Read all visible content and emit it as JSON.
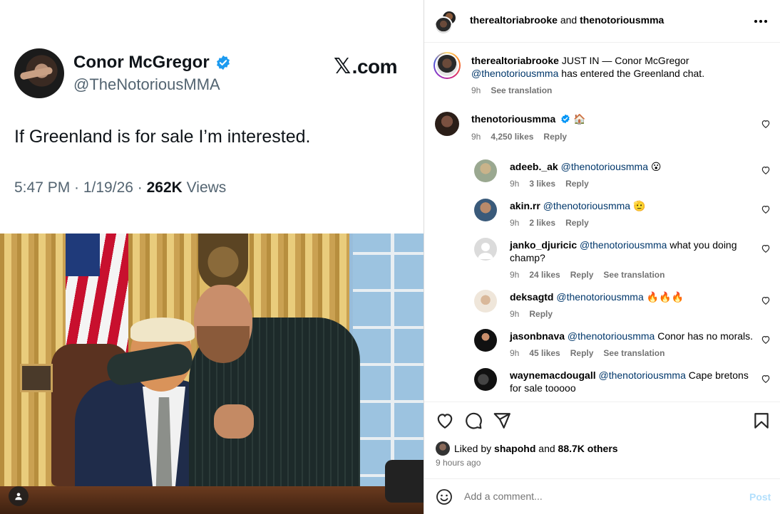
{
  "tweet": {
    "name": "Conor McGregor",
    "handle": "@TheNotoriousMMA",
    "site": "X.com",
    "site_x": "𝕏",
    "site_rest": ".com",
    "text": "If Greenland is for sale I’m interested.",
    "time": "5:47 PM · 1/19/26 · ",
    "views_count": "262K",
    "views_label": " Views"
  },
  "header": {
    "user1": "therealtoriabrooke",
    "and": " and ",
    "user2": "thenotoriousmma"
  },
  "caption": {
    "user": "therealtoriabrooke",
    "text": " JUST IN — Conor McGregor ",
    "mention": "@thenotoriousmma",
    "text2": " has entered the Greenland chat.",
    "time": "9h",
    "translate": "See translation"
  },
  "top_comment": {
    "user": "thenotoriousmma",
    "emoji": "🏠",
    "time": "9h",
    "likes": "4,250 likes",
    "reply": "Reply"
  },
  "replies": [
    {
      "user": "adeeb._ak",
      "mention": "@thenotoriousmma",
      "text": " 😮",
      "time": "9h",
      "likes": "3 likes",
      "reply": "Reply",
      "translate": ""
    },
    {
      "user": "akin.rr",
      "mention": "@thenotoriousmma",
      "text": " 🫡",
      "time": "9h",
      "likes": "2 likes",
      "reply": "Reply",
      "translate": ""
    },
    {
      "user": "janko_djuricic",
      "mention": "@thenotoriousmma",
      "text": " what you doing champ?",
      "time": "9h",
      "likes": "24 likes",
      "reply": "Reply",
      "translate": "See translation"
    },
    {
      "user": "deksagtd",
      "mention": "@thenotoriousmma",
      "text": " 🔥🔥🔥",
      "time": "9h",
      "likes": "",
      "reply": "Reply",
      "translate": ""
    },
    {
      "user": "jasonbnava",
      "mention": "@thenotoriousmma",
      "text": " Conor has no morals.",
      "time": "9h",
      "likes": "45 likes",
      "reply": "Reply",
      "translate": "See translation"
    },
    {
      "user": "waynemacdougall",
      "mention": "@thenotoriousmma",
      "text": " Cape bretons for sale tooooo",
      "time": "",
      "likes": "",
      "reply": "",
      "translate": ""
    }
  ],
  "liked": {
    "prefix": "Liked by ",
    "user": "shapohd",
    "and": " and ",
    "others": "88.7K others"
  },
  "posted_ago": "9 hours ago",
  "add_comment": {
    "placeholder": "Add a comment...",
    "post": "Post"
  }
}
